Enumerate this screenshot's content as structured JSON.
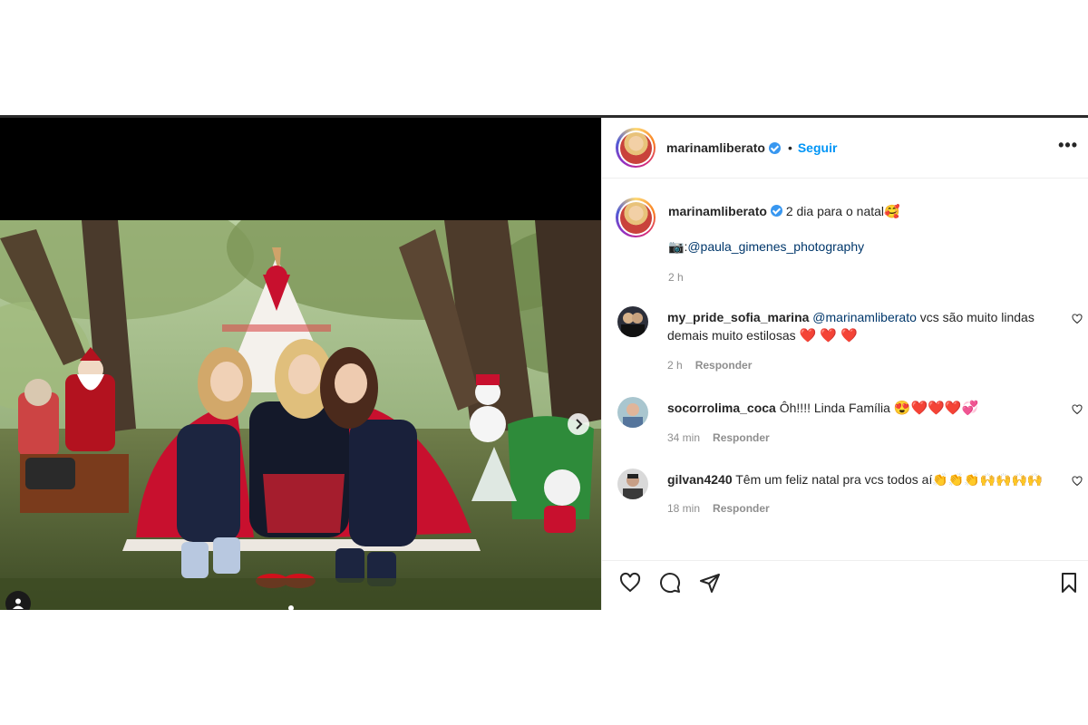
{
  "post": {
    "username": "marinamliberato",
    "follow_label": "Seguir",
    "separator": "•",
    "more_label": "•••"
  },
  "caption": {
    "username": "marinamliberato",
    "text": "2 dia para o natal",
    "emoji": "🥰",
    "camera_emoji": "📷",
    "credit_prefix": ":",
    "credit_mention": "@paula_gimenes_photography",
    "time": "2 h"
  },
  "comments": [
    {
      "username": "my_pride_sofia_marina",
      "mention": "@marinamliberato",
      "text": " vcs são muito lindas demais muito estilosas ",
      "emoji": "❤️ ❤️ ❤️",
      "time": "2 h",
      "reply_label": "Responder"
    },
    {
      "username": "socorrolima_coca",
      "text": "Ôh!!!! Linda Família ",
      "emoji": "😍❤️❤️❤️💞",
      "time": "34 min",
      "reply_label": "Responder"
    },
    {
      "username": "gilvan4240",
      "text": "Têm um feliz natal pra vcs todos aí",
      "emoji": "👏👏👏🙌🙌🙌🙌",
      "time": "18 min",
      "reply_label": "Responder"
    }
  ],
  "icons": {
    "like": "heart-icon",
    "comment": "comment-icon",
    "share": "paper-plane-icon",
    "save": "bookmark-icon",
    "next": "chevron-right-icon",
    "tag": "user-tag-icon"
  },
  "colors": {
    "accent": "#0095f6",
    "verified": "#3897f0",
    "text": "#262626",
    "muted": "#8e8e8e",
    "mention": "#00376b"
  }
}
